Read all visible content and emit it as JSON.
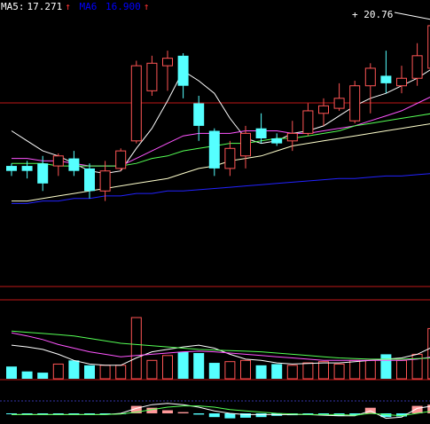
{
  "legend": {
    "ma5_label": "MA5:",
    "ma5_value": "17.271",
    "ma5_arrow": "↑",
    "ma10_label": "MA6",
    "ma10_value": "16.900",
    "ma10_arrow": "↑"
  },
  "high_marker": {
    "plus": "+",
    "value": "20.76"
  },
  "colors": {
    "up": "#ff5555",
    "down": "#55ffff",
    "frame": "#c01818",
    "ma5": "#ffffff",
    "ma10": "#ff55ff",
    "ma20": "#55ff55",
    "ma60": "#ffffcc",
    "ma120": "#2222ff"
  },
  "chart_data": [
    {
      "type": "candlestick",
      "title": "",
      "ylim": [
        11.0,
        21.2
      ],
      "candles": [
        {
          "o": 15.0,
          "c": 14.8,
          "h": 15.1,
          "l": 14.6
        },
        {
          "o": 15.0,
          "c": 14.8,
          "h": 15.2,
          "l": 14.5
        },
        {
          "o": 15.1,
          "c": 14.3,
          "h": 15.4,
          "l": 14.0
        },
        {
          "o": 15.0,
          "c": 15.4,
          "h": 15.5,
          "l": 14.6
        },
        {
          "o": 15.3,
          "c": 14.8,
          "h": 15.6,
          "l": 14.6
        },
        {
          "o": 14.9,
          "c": 14.0,
          "h": 15.1,
          "l": 13.7
        },
        {
          "o": 14.0,
          "c": 14.8,
          "h": 15.2,
          "l": 13.6
        },
        {
          "o": 14.9,
          "c": 15.6,
          "h": 15.7,
          "l": 14.8
        },
        {
          "o": 16.0,
          "c": 19.0,
          "h": 19.2,
          "l": 15.9
        },
        {
          "o": 18.0,
          "c": 19.1,
          "h": 19.4,
          "l": 17.8
        },
        {
          "o": 19.0,
          "c": 19.3,
          "h": 19.6,
          "l": 18.0
        },
        {
          "o": 19.4,
          "c": 18.2,
          "h": 19.5,
          "l": 17.7
        },
        {
          "o": 17.5,
          "c": 16.6,
          "h": 17.8,
          "l": 16.0
        },
        {
          "o": 16.4,
          "c": 14.9,
          "h": 16.5,
          "l": 14.6
        },
        {
          "o": 14.9,
          "c": 15.7,
          "h": 16.0,
          "l": 14.6
        },
        {
          "o": 15.4,
          "c": 16.3,
          "h": 16.6,
          "l": 14.9
        },
        {
          "o": 16.5,
          "c": 16.1,
          "h": 17.1,
          "l": 15.9
        },
        {
          "o": 16.1,
          "c": 15.9,
          "h": 16.3,
          "l": 15.8
        },
        {
          "o": 16.0,
          "c": 16.3,
          "h": 16.8,
          "l": 15.6
        },
        {
          "o": 16.3,
          "c": 17.2,
          "h": 17.5,
          "l": 16.2
        },
        {
          "o": 17.1,
          "c": 17.4,
          "h": 17.7,
          "l": 16.6
        },
        {
          "o": 17.3,
          "c": 17.7,
          "h": 18.3,
          "l": 17.2
        },
        {
          "o": 16.8,
          "c": 18.2,
          "h": 18.4,
          "l": 16.7
        },
        {
          "o": 18.2,
          "c": 18.9,
          "h": 19.1,
          "l": 17.1
        },
        {
          "o": 18.6,
          "c": 18.3,
          "h": 19.6,
          "l": 17.9
        },
        {
          "o": 18.2,
          "c": 18.5,
          "h": 19.0,
          "l": 17.9
        },
        {
          "o": 18.5,
          "c": 19.4,
          "h": 19.9,
          "l": 18.2
        },
        {
          "o": 18.9,
          "c": 20.6,
          "h": 20.76,
          "l": 18.8
        }
      ],
      "ma_lines": [
        {
          "name": "MA5",
          "values": [
            16.4,
            16.0,
            15.6,
            15.4,
            15.1,
            14.8,
            14.7,
            14.8,
            15.7,
            16.5,
            17.6,
            18.8,
            18.4,
            17.9,
            16.9,
            16.1,
            15.9,
            16.0,
            16.3,
            16.4,
            16.6,
            17.0,
            17.4,
            17.7,
            17.9,
            18.2,
            18.5,
            18.9
          ]
        },
        {
          "name": "MA10",
          "values": [
            15.3,
            15.3,
            15.2,
            15.2,
            15.1,
            15.0,
            15.0,
            15.0,
            15.3,
            15.6,
            15.9,
            16.2,
            16.3,
            16.3,
            16.3,
            16.4,
            16.4,
            16.4,
            16.3,
            16.3,
            16.4,
            16.5,
            16.6,
            16.8,
            17.0,
            17.2,
            17.5,
            17.8
          ]
        },
        {
          "name": "MA20",
          "values": [
            15.1,
            15.1,
            15.1,
            15.0,
            15.0,
            15.0,
            15.0,
            15.0,
            15.1,
            15.3,
            15.4,
            15.6,
            15.7,
            15.8,
            15.9,
            15.9,
            16.0,
            16.1,
            16.1,
            16.2,
            16.3,
            16.4,
            16.6,
            16.7,
            16.8,
            16.9,
            17.0,
            17.1
          ]
        },
        {
          "name": "MA60",
          "values": [
            13.6,
            13.6,
            13.7,
            13.8,
            13.9,
            14.0,
            14.1,
            14.2,
            14.3,
            14.4,
            14.5,
            14.7,
            14.9,
            15.0,
            15.2,
            15.3,
            15.4,
            15.6,
            15.8,
            15.9,
            16.0,
            16.1,
            16.2,
            16.3,
            16.4,
            16.5,
            16.6,
            16.7
          ]
        },
        {
          "name": "MA120",
          "values": [
            13.5,
            13.5,
            13.6,
            13.6,
            13.7,
            13.7,
            13.8,
            13.8,
            13.9,
            13.9,
            14.0,
            14.0,
            14.05,
            14.1,
            14.15,
            14.2,
            14.25,
            14.3,
            14.35,
            14.4,
            14.45,
            14.5,
            14.5,
            14.55,
            14.6,
            14.6,
            14.65,
            14.7
          ]
        }
      ]
    },
    {
      "type": "bar",
      "title": "",
      "ylim": [
        0,
        100
      ],
      "values": [
        20,
        12,
        10,
        24,
        30,
        22,
        22,
        22,
        100,
        30,
        38,
        44,
        42,
        26,
        28,
        30,
        22,
        24,
        22,
        26,
        28,
        24,
        30,
        30,
        40,
        30,
        40,
        82
      ],
      "up": [
        false,
        false,
        false,
        true,
        false,
        false,
        true,
        true,
        true,
        true,
        true,
        false,
        false,
        false,
        true,
        true,
        false,
        false,
        true,
        true,
        true,
        true,
        true,
        true,
        false,
        true,
        true,
        true
      ],
      "ma_lines": [
        {
          "name": "VMA5",
          "values": [
            55,
            52,
            48,
            40,
            30,
            24,
            22,
            22,
            34,
            44,
            48,
            52,
            55,
            50,
            40,
            32,
            30,
            26,
            24,
            25,
            26,
            26,
            28,
            30,
            32,
            34,
            40,
            52
          ]
        },
        {
          "name": "VMA10",
          "values": [
            75,
            70,
            64,
            56,
            50,
            44,
            40,
            36,
            38,
            40,
            42,
            44,
            45,
            44,
            42,
            40,
            38,
            36,
            34,
            32,
            30,
            30,
            30,
            30,
            30,
            30,
            32,
            36
          ]
        },
        {
          "name": "VMA20",
          "values": [
            78,
            76,
            74,
            72,
            70,
            66,
            62,
            58,
            56,
            54,
            52,
            50,
            48,
            47,
            46,
            45,
            44,
            42,
            40,
            38,
            36,
            34,
            33,
            32,
            32,
            32,
            33,
            34
          ]
        }
      ]
    },
    {
      "type": "bar",
      "title": "",
      "ylim": [
        -1,
        1
      ],
      "values": [
        -0.05,
        -0.05,
        -0.05,
        -0.05,
        -0.05,
        -0.05,
        -0.05,
        -0.05,
        0.6,
        0.45,
        0.25,
        0.1,
        -0.1,
        -0.3,
        -0.4,
        -0.35,
        -0.3,
        -0.2,
        -0.15,
        -0.1,
        -0.15,
        -0.2,
        -0.15,
        0.45,
        -0.3,
        -0.25,
        0.6,
        0.7
      ],
      "lines": [
        {
          "name": "DIF",
          "values": [
            -0.1,
            -0.1,
            -0.1,
            -0.1,
            -0.1,
            -0.1,
            -0.1,
            0.0,
            0.4,
            0.7,
            0.8,
            0.7,
            0.5,
            0.2,
            0.0,
            -0.1,
            -0.1,
            -0.1,
            -0.1,
            -0.1,
            -0.15,
            -0.2,
            -0.2,
            0.2,
            -0.4,
            -0.3,
            0.4,
            0.6
          ]
        },
        {
          "name": "DEA",
          "values": [
            -0.1,
            -0.1,
            -0.1,
            -0.1,
            -0.1,
            -0.1,
            -0.1,
            -0.05,
            0.1,
            0.3,
            0.5,
            0.6,
            0.6,
            0.5,
            0.3,
            0.2,
            0.1,
            0.0,
            -0.05,
            -0.1,
            -0.1,
            -0.1,
            -0.15,
            0.0,
            -0.1,
            -0.2,
            0.0,
            0.2
          ]
        }
      ]
    }
  ]
}
